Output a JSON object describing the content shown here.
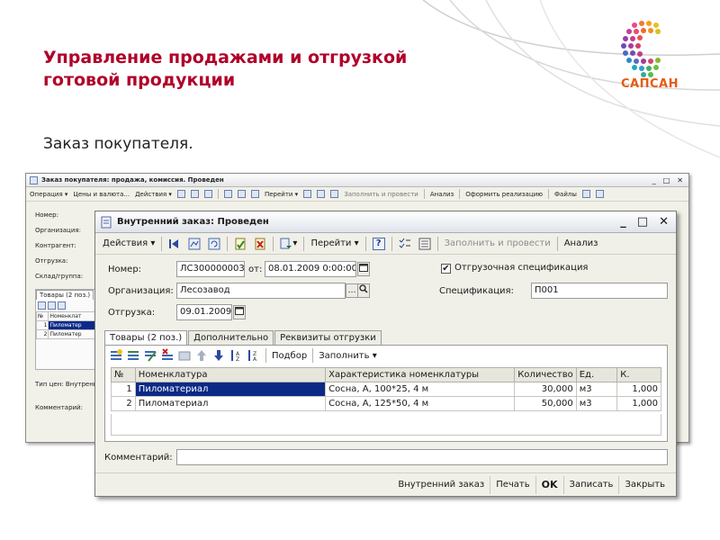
{
  "slide": {
    "title": "Управление продажами и отгрузкой готовой продукции",
    "subtitle": "Заказ покупателя.",
    "logo_text": "САПСАН",
    "colors": {
      "title": "#b0002a",
      "logo_text": "#e85a10",
      "selection": "#0b2a86"
    }
  },
  "back_window": {
    "title": "Заказ покупателя: продажа, комиссия. Проведен",
    "toolbar": [
      "Операция ▾",
      "Цены и валюта...",
      "Действия ▾",
      "Перейти ▾",
      "Заполнить и провести",
      "Анализ",
      "Оформить реализацию",
      "Файлы"
    ],
    "fields": [
      "Номер:",
      "Организация:",
      "Контрагент:",
      "Отгрузка:",
      "Склад/группа:"
    ],
    "tab_label": "Товары (2 поз.)",
    "grid_headers": [
      "№",
      "Номенклат"
    ],
    "rows": [
      {
        "n": "1",
        "name": "Пиломатер"
      },
      {
        "n": "2",
        "name": "Пиломатер"
      }
    ],
    "price_type": "Тип цен: Внутренн",
    "comment_label": "Комментарий:"
  },
  "front_window": {
    "title": "Внутренний заказ: Проведен",
    "toolbar": {
      "actions": "Действия",
      "goto": "Перейти",
      "help": "?",
      "fill_post": "Заполнить и провести",
      "analysis": "Анализ"
    },
    "form": {
      "number_label": "Номер:",
      "number_value": "ЛС300000003",
      "from_label": "от:",
      "date_value": "08.01.2009 0:00:00",
      "org_label": "Организация:",
      "org_value": "Лесозавод",
      "ship_label": "Отгрузка:",
      "ship_value": "09.01.2009",
      "ship_spec_label": "Отгрузочная спецификация",
      "ship_spec_checked": true,
      "spec_label": "Спецификация:",
      "spec_value": "П001"
    },
    "tabs": [
      "Товары (2 поз.)",
      "Дополнительно",
      "Реквизиты отгрузки"
    ],
    "panel_toolbar": {
      "pick": "Подбор",
      "fill": "Заполнить"
    },
    "grid": {
      "headers": [
        "№",
        "Номенклатура",
        "Характеристика номенклатуры",
        "Количество",
        "Ед.",
        "К."
      ],
      "rows": [
        {
          "n": "1",
          "name": "Пиломатериал",
          "char": "Сосна, А, 100*25, 4 м",
          "qty": "30,000",
          "unit": "м3",
          "k": "1,000"
        },
        {
          "n": "2",
          "name": "Пиломатериал",
          "char": "Сосна, А, 125*50, 4 м",
          "qty": "50,000",
          "unit": "м3",
          "k": "1,000"
        }
      ]
    },
    "comment_label": "Комментарий:",
    "comment_value": "",
    "footer": [
      "Внутренний заказ",
      "Печать",
      "OK",
      "Записать",
      "Закрыть"
    ]
  }
}
